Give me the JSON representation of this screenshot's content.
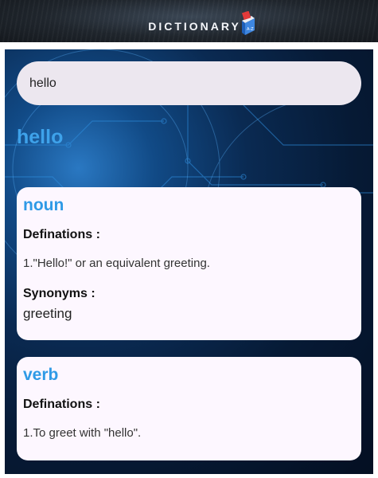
{
  "header": {
    "logo_text": "DICTIONARY",
    "logo_icon": "book-icon",
    "book_letters": "A-Z"
  },
  "search": {
    "value": "hello"
  },
  "result": {
    "word": "hello",
    "meanings": [
      {
        "part_of_speech": "noun",
        "definitions_label": "Definations :",
        "definitions": [
          "1.\"Hello!\" or an equivalent greeting."
        ],
        "synonyms_label": "Synonyms :",
        "synonyms": "greeting"
      },
      {
        "part_of_speech": "verb",
        "definitions_label": "Definations :",
        "definitions": [
          "1.To greet with \"hello\"."
        ]
      }
    ]
  },
  "colors": {
    "accent": "#3ea2ea",
    "card": "#fdf7ff",
    "search_bg": "#ece7ef",
    "header_bg": "#1f252c"
  }
}
